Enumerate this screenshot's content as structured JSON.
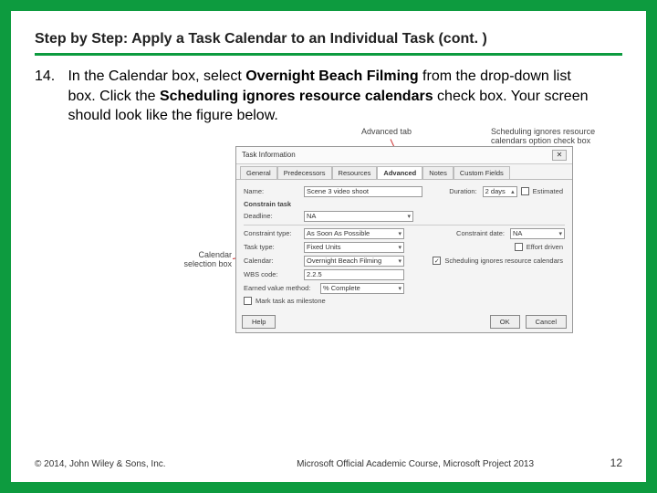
{
  "heading": "Step by Step: Apply a Task Calendar to an Individual Task (cont. )",
  "step": {
    "number": "14.",
    "p1a": "In the Calendar box, select ",
    "p1b": "Overnight Beach Filming ",
    "p1c": "from the drop-down list box. Click the ",
    "p1d": "Scheduling ignores resource calendars ",
    "p1e": "check box. Your screen should look like the figure below."
  },
  "callouts": {
    "advanced": "Advanced tab",
    "chkbox": "Scheduling ignores resource calendars option check box",
    "calbox": "Calendar selection box"
  },
  "dialog": {
    "title": "Task Information",
    "close": "✕",
    "tabs": [
      "General",
      "Predecessors",
      "Resources",
      "Advanced",
      "Notes",
      "Custom Fields"
    ],
    "fields": {
      "name_lbl": "Name:",
      "name_val": "Scene 3 video shoot",
      "duration_lbl": "Duration:",
      "duration_val": "2 days",
      "estimated_lbl": "Estimated",
      "section_constrain": "Constrain task",
      "deadline_lbl": "Deadline:",
      "deadline_val": "NA",
      "ctype_lbl": "Constraint type:",
      "ctype_val": "As Soon As Possible",
      "cdate_lbl": "Constraint date:",
      "cdate_val": "NA",
      "tasktype_lbl": "Task type:",
      "tasktype_val": "Fixed Units",
      "effort_lbl": "Effort driven",
      "cal_lbl": "Calendar:",
      "cal_val": "Overnight Beach Filming",
      "sched_lbl": "Scheduling ignores resource calendars",
      "wbs_lbl": "WBS code:",
      "wbs_val": "2.2.5",
      "evm_lbl": "Earned value method:",
      "evm_val": "% Complete",
      "milestone_lbl": "Mark task as milestone"
    },
    "buttons": {
      "help": "Help",
      "ok": "OK",
      "cancel": "Cancel"
    }
  },
  "footer": {
    "left": "© 2014, John Wiley & Sons, Inc.",
    "mid": "Microsoft Official Academic Course, Microsoft Project 2013",
    "page": "12"
  }
}
